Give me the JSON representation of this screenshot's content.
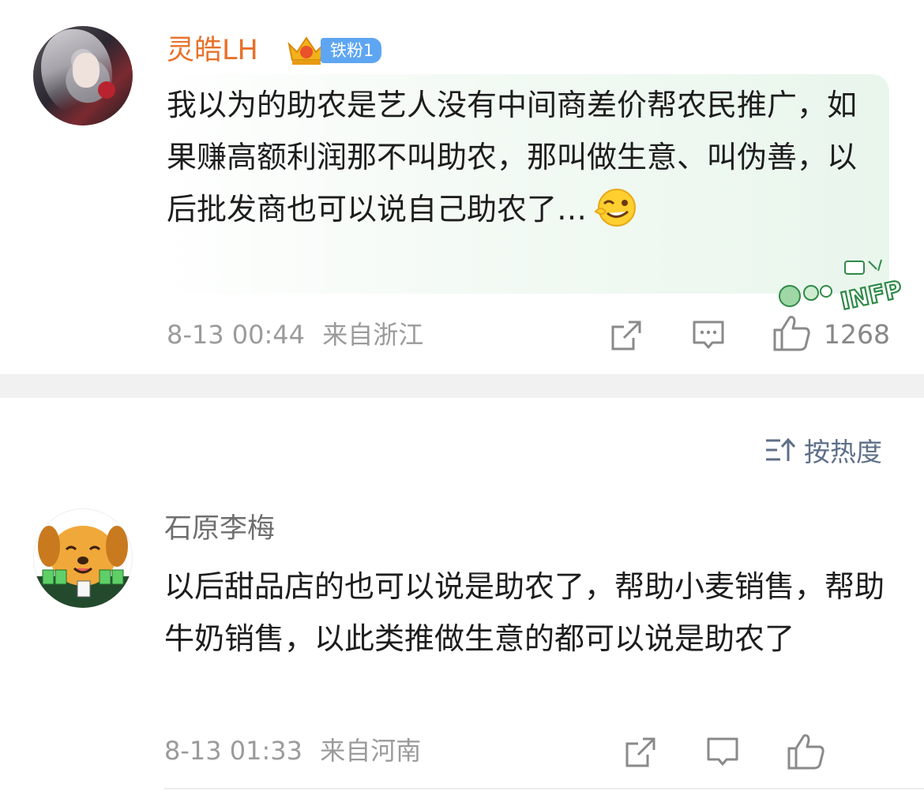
{
  "comments": [
    {
      "username": "灵皓LH",
      "badge": "铁粉1",
      "text": "我以为的助农是艺人没有中间商差价帮农民推广，如果赚高额利润那不叫助农，那叫做生意、叫伪善，以后批发商也可以说自己助农了…",
      "emoji": "wink-face-emoji",
      "card_decoration": "INFP",
      "timestamp": "8-13 00:44",
      "location": "来自浙江",
      "likes": "1268",
      "accent_color": "#e7712a"
    },
    {
      "username": "石原李梅",
      "text": "以后甜品店的也可以说是助农了，帮助小麦销售，帮助牛奶销售，以此类推做生意的都可以说是助农了",
      "timestamp": "8-13 01:33",
      "location": "来自河南"
    }
  ],
  "sort": {
    "label": "按热度",
    "icon": "sort-icon"
  },
  "colors": {
    "badge_blue": "#5ea6f2",
    "meta_gray": "#9b9b9b",
    "sort_blue_gray": "#5e6f88"
  }
}
